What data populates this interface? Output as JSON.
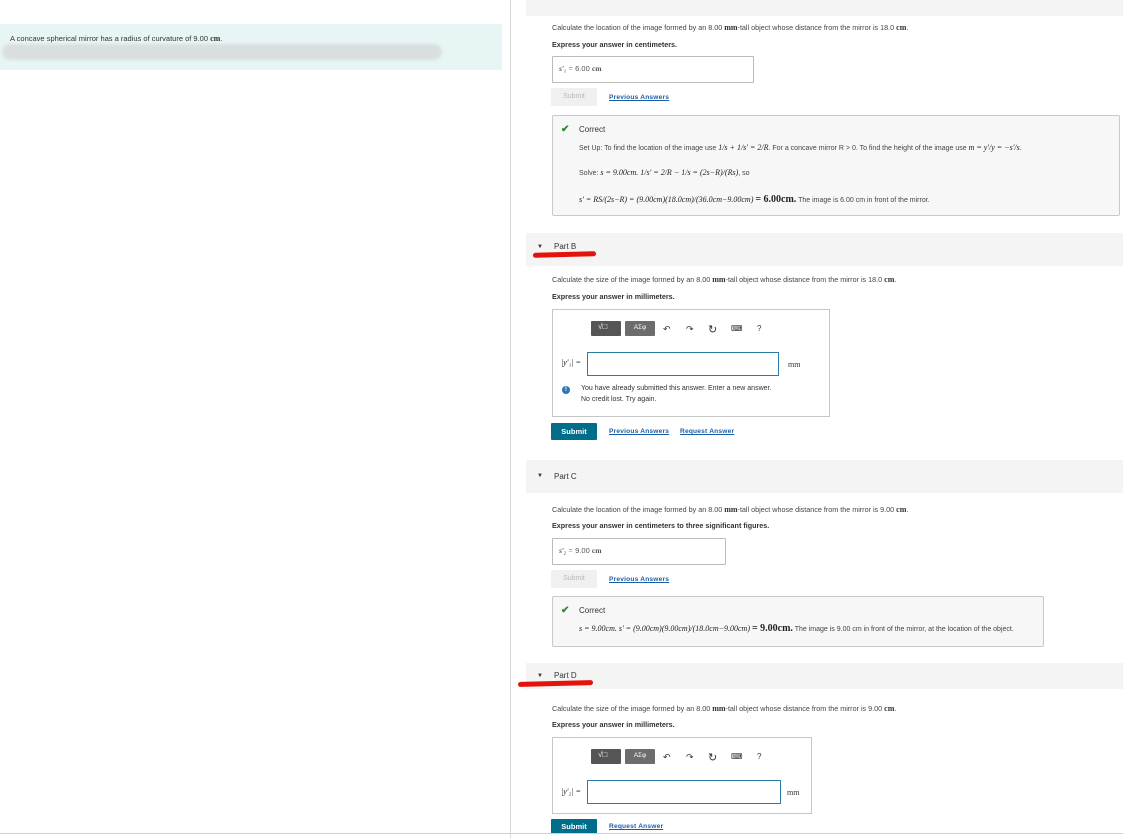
{
  "left_problem": {
    "text": "A concave spherical mirror has a radius of curvature of 9.00",
    "unit": "cm"
  },
  "part_a": {
    "question": "Calculate the location of the image formed by an 8.00",
    "question_unit": "mm",
    "question_rest": "-tall object whose distance from the mirror is 18.0",
    "question_unit2": "cm",
    "instructions": "Express your answer in centimeters.",
    "var_label": "s'₁ =",
    "value": "6.00",
    "unit": "cm",
    "submit_label": "Submit",
    "previous_answers": "Previous Answers",
    "feedback": {
      "status": "Correct",
      "setup": "Set Up: To find the location of the image use",
      "setup_eq": "1/s + 1/s' = 2/R",
      "setup_rest": ". For a concave mirror R > 0. To find the height of the image use",
      "setup_eq2": "m = y'/y = −s'/s",
      "solve_label": "Solve:",
      "solve_eq": "s = 9.00cm. 1/s' = 2/R − 1/s = (2s−R)/(Rs)",
      "solve_so": ", so",
      "result_eq": "s' = RS/(2s−R) = (9.00cm)(18.0cm)/(36.0cm−9.00cm)",
      "result_val": "= 6.00cm.",
      "result_text": "The image is 6.00 cm in front of the mirror."
    }
  },
  "part_b": {
    "label": "Part B",
    "question": "Calculate the size of the image formed by an 8.00",
    "question_unit": "mm",
    "question_rest": "-tall object whose distance from the mirror is 18.0",
    "question_unit2": "cm",
    "instructions": "Express your answer in millimeters.",
    "var_label": "|y'₁| =",
    "unit": "mm",
    "warning": "You have already submitted this answer. Enter a new answer.",
    "warning2": "No credit lost. Try again.",
    "submit_label": "Submit",
    "previous_answers": "Previous Answers",
    "request_answer": "Request Answer"
  },
  "part_c": {
    "label": "Part C",
    "question": "Calculate the location of the image formed by an 8.00",
    "question_unit": "mm",
    "question_rest": "-tall object whose distance from the mirror is 9.00",
    "question_unit2": "cm",
    "instructions": "Express your answer in centimeters to three significant figures.",
    "var_label": "s'₂ =",
    "value": "9.00",
    "unit": "cm",
    "submit_label": "Submit",
    "previous_answers": "Previous Answers",
    "feedback": {
      "status": "Correct",
      "eq": "s = 9.00cm. s' = (9.00cm)(9.00cm)/(18.0cm−9.00cm)",
      "result_val": "= 9.00cm.",
      "result_text": "The image is 9.00 cm in front of the mirror, at the location of the object."
    }
  },
  "part_d": {
    "label": "Part D",
    "question": "Calculate the size of the image formed by an 8.00",
    "question_unit": "mm",
    "question_rest": "-tall object whose distance from the mirror is 9.00",
    "question_unit2": "cm",
    "instructions": "Express your answer in millimeters.",
    "var_label": "|y'₂| =",
    "unit": "mm",
    "submit_label": "Submit",
    "request_answer": "Request Answer"
  },
  "toolbar": {
    "template_label": "√□",
    "greek_label": "ΑΣφ",
    "undo": "↶",
    "redo": "↷",
    "reset": "↻",
    "keyboard": "⌨",
    "help": "?"
  },
  "colors": {
    "accent": "#006e8a",
    "correct": "#2e8b2e",
    "link": "#1a5ea8",
    "annotation": "#e3120b"
  }
}
